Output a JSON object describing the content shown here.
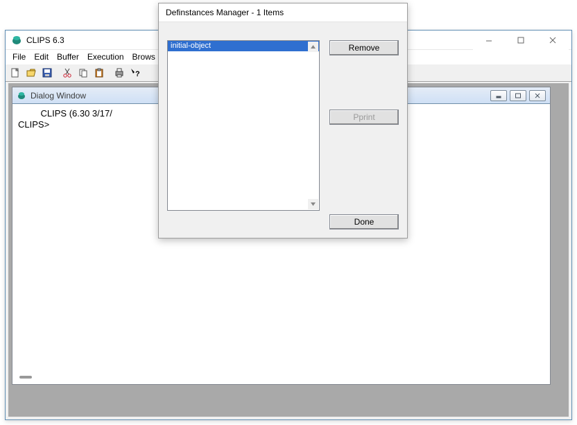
{
  "main": {
    "title": "CLIPS 6.3",
    "menus": [
      "File",
      "Edit",
      "Buffer",
      "Execution",
      "Brows"
    ],
    "toolbar_icons": [
      "new",
      "open",
      "save",
      "cut",
      "copy",
      "paste",
      "print",
      "help"
    ]
  },
  "dialog_window": {
    "title": "Dialog Window",
    "line1": "         CLIPS (6.30 3/17/",
    "line2": "CLIPS>"
  },
  "mgr": {
    "title": "Definstances Manager -    1 Items",
    "items": [
      "initial-object"
    ],
    "selected_index": 0,
    "buttons": {
      "remove": "Remove",
      "pprint": "Pprint",
      "done": "Done"
    }
  },
  "colors": {
    "selection": "#2f6fd0"
  }
}
